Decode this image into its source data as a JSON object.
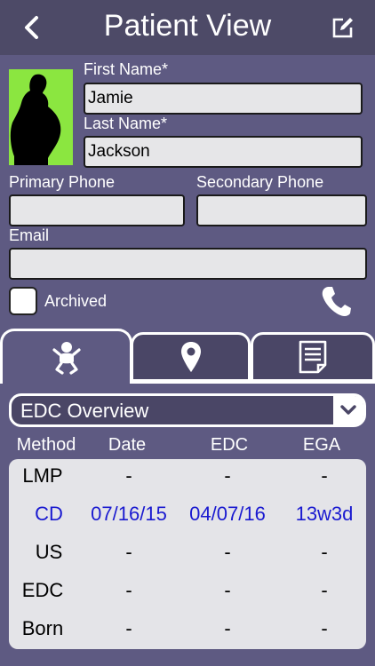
{
  "header": {
    "title": "Patient View",
    "back_icon": "chevron-left-icon",
    "edit_icon": "edit-icon"
  },
  "patient": {
    "first_name_label": "First Name*",
    "first_name": "Jamie",
    "last_name_label": "Last Name*",
    "last_name": "Jackson",
    "primary_phone_label": "Primary Phone",
    "primary_phone": "",
    "secondary_phone_label": "Secondary Phone",
    "secondary_phone": "",
    "email_label": "Email",
    "email": "",
    "archived_label": "Archived",
    "archived": false
  },
  "tabs": [
    {
      "icon": "baby-icon",
      "active": true
    },
    {
      "icon": "location-pin-icon",
      "active": false
    },
    {
      "icon": "notes-icon",
      "active": false
    }
  ],
  "overview": {
    "selected": "EDC Overview",
    "columns": [
      "Method",
      "Date",
      "EDC",
      "EGA"
    ],
    "rows": [
      {
        "method": "LMP",
        "date": "-",
        "edc": "-",
        "ega": "-",
        "highlight": false
      },
      {
        "method": "CD",
        "date": "07/16/15",
        "edc": "04/07/16",
        "ega": "13w3d",
        "highlight": true
      },
      {
        "method": "US",
        "date": "-",
        "edc": "-",
        "ega": "-",
        "highlight": false
      },
      {
        "method": "EDC",
        "date": "-",
        "edc": "-",
        "ega": "-",
        "highlight": false
      },
      {
        "method": "Born",
        "date": "-",
        "edc": "-",
        "ega": "-",
        "highlight": false
      }
    ]
  },
  "colors": {
    "background": "#5e5a82",
    "header": "#4d4a67",
    "photo_bg": "#8be640",
    "highlight_text": "#1a1ad0"
  }
}
